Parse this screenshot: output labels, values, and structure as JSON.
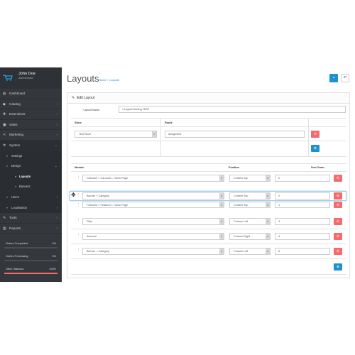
{
  "user": {
    "name": "John Doe",
    "role": "Administrator"
  },
  "nav": {
    "dashboard": "Dashboard",
    "catalog": "Catalog",
    "extensions": "Extensions",
    "sales": "Sales",
    "marketing": "Marketing",
    "system": "System",
    "settings": "Settings",
    "design": "Design",
    "layouts": "Layouts",
    "banners": "Banners",
    "users": "Users",
    "localisation": "Localisation",
    "tools": "Tools",
    "reports": "Reports"
  },
  "stats": [
    {
      "label": "Orders Completed",
      "value": "0%",
      "fill": 0
    },
    {
      "label": "Orders Processing",
      "value": "0%",
      "fill": 0
    },
    {
      "label": "Other Statuses",
      "value": "100%",
      "fill": 1.0
    }
  ],
  "colors": {
    "accent": "#1e91cf",
    "danger": "#f56b6b",
    "sidebar": "#34373b",
    "stat_fill": "#f56b6b"
  },
  "page": {
    "title": "Layouts",
    "crumb_home": "Home",
    "crumb_sep": "»",
    "crumb_current": "Layouts"
  },
  "panel": {
    "heading": "Edit Layout"
  },
  "form": {
    "layout_name_label": "Layout Name",
    "layout_name_value": "1 Layout Sorting TEST",
    "store_header": "Store",
    "route_header": "Route",
    "store_value": "Test Store",
    "route_value": "design/test"
  },
  "modules": {
    "col_module": "Module",
    "col_position": "Position",
    "col_sort": "Sort Order",
    "rows": [
      {
        "module": "Carousel > Carousel - Home Page",
        "position": "Content Top",
        "sort": "0"
      },
      {
        "module": "Banner > Category",
        "position": "Content Top",
        "sort": "2"
      },
      {
        "module": "Featured > Featured - Home Page",
        "position": "Content Top",
        "sort": "1"
      },
      {
        "module": "Filter",
        "position": "Column Left",
        "sort": "3"
      },
      {
        "module": "Account",
        "position": "Column Right",
        "sort": "4"
      },
      {
        "module": "Banner > Category",
        "position": "Column Left",
        "sort": "5"
      }
    ]
  },
  "icons": {
    "save": "save-icon",
    "back": "reply-icon",
    "remove": "minus-circle-icon",
    "add": "plus-circle-icon",
    "drag": "move-icon"
  }
}
